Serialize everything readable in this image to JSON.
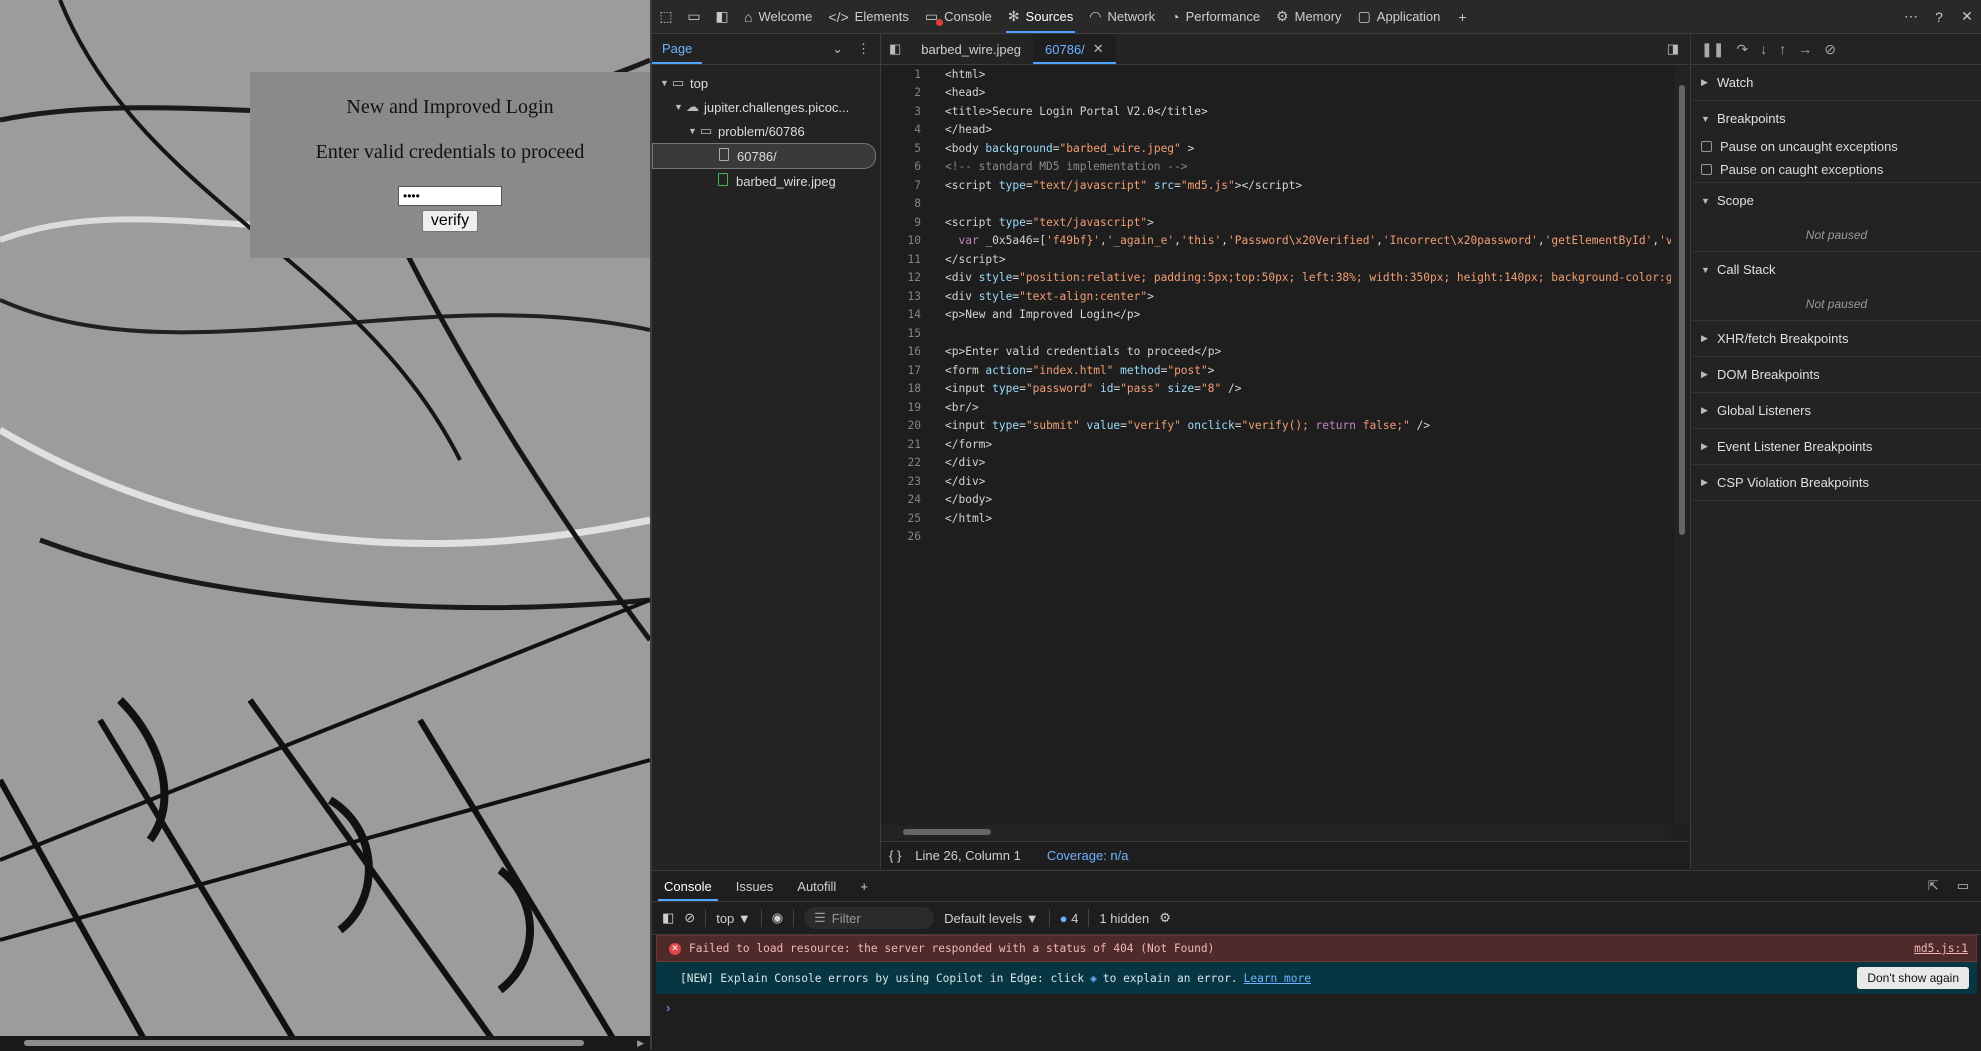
{
  "page": {
    "heading": "New and Improved Login",
    "subheading": "Enter valid credentials to proceed",
    "password_value": "••••",
    "verify_label": "verify"
  },
  "toolbar": {
    "tabs": [
      {
        "label": "Welcome",
        "icon": "home-icon"
      },
      {
        "label": "Elements",
        "icon": "code-icon"
      },
      {
        "label": "Console",
        "icon": "console-icon"
      },
      {
        "label": "Sources",
        "icon": "bug-icon"
      },
      {
        "label": "Network",
        "icon": "wifi-icon"
      },
      {
        "label": "Performance",
        "icon": "gauge-icon"
      },
      {
        "label": "Memory",
        "icon": "chip-icon"
      },
      {
        "label": "Application",
        "icon": "app-icon"
      }
    ],
    "active_tab": "Sources"
  },
  "navigator": {
    "tab": "Page",
    "tree": [
      {
        "label": "top",
        "depth": 0
      },
      {
        "label": "jupiter.challenges.picoc...",
        "depth": 1
      },
      {
        "label": "problem/60786",
        "depth": 2
      },
      {
        "label": "60786/",
        "depth": 3
      },
      {
        "label": "barbed_wire.jpeg",
        "depth": 3
      }
    ]
  },
  "editor": {
    "tabs": [
      "barbed_wire.jpeg",
      "60786/"
    ],
    "active_tab": "60786/",
    "status": "Line 26, Column 1",
    "coverage": "Coverage: n/a"
  },
  "debugger": {
    "watch": "Watch",
    "breakpoints": "Breakpoints",
    "pause_uncaught": "Pause on uncaught exceptions",
    "pause_caught": "Pause on caught exceptions",
    "scope": "Scope",
    "not_paused_1": "Not paused",
    "call_stack": "Call Stack",
    "not_paused_2": "Not paused",
    "xhr": "XHR/fetch Breakpoints",
    "dom": "DOM Breakpoints",
    "global": "Global Listeners",
    "event": "Event Listener Breakpoints",
    "csp": "CSP Violation Breakpoints"
  },
  "drawer": {
    "tabs": [
      "Console",
      "Issues",
      "Autofill"
    ],
    "context": "top",
    "filter_placeholder": "Filter",
    "levels": "Default levels",
    "issue_count": "4",
    "hidden": "1 hidden",
    "error_text": "Failed to load resource: the server responded with a status of 404 (Not Found)",
    "error_source": "md5.js:1",
    "info_text_1": "[NEW] Explain Console errors by using Copilot in Edge: click",
    "info_text_2": "to explain an error.",
    "learn_more": "Learn more",
    "dont_show": "Don't show again"
  }
}
